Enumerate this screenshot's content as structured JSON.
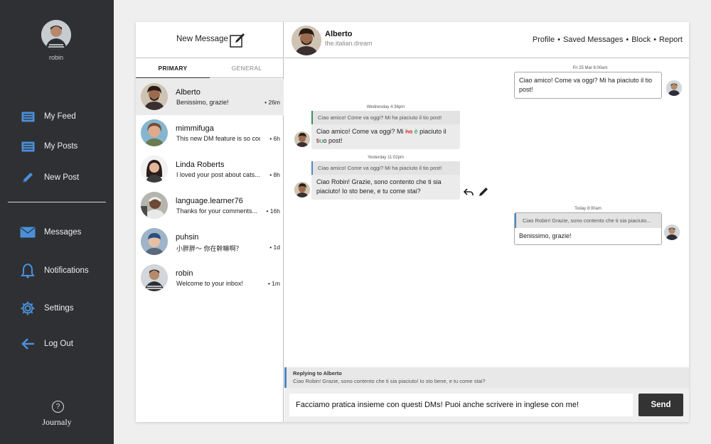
{
  "sidebar": {
    "user_name": "robin",
    "nav": [
      {
        "label": "My Feed",
        "icon": "feed-icon"
      },
      {
        "label": "My Posts",
        "icon": "posts-icon"
      },
      {
        "label": "New Post",
        "icon": "pencil-icon"
      },
      {
        "label": "Messages",
        "icon": "envelope-icon"
      },
      {
        "label": "Notifications",
        "icon": "bell-icon"
      },
      {
        "label": "Settings",
        "icon": "gear-icon"
      },
      {
        "label": "Log Out",
        "icon": "arrow-left-icon"
      }
    ],
    "help": "?",
    "brand": "Journaly",
    "accent": "#4a90d9"
  },
  "inbox": {
    "new_message_label": "New Message",
    "tabs": [
      "PRIMARY",
      "GENERAL"
    ],
    "conversations": [
      {
        "name": "Alberto",
        "preview": "Benissimo, grazie!",
        "time": "• 26m",
        "active": true
      },
      {
        "name": "mimmifuga",
        "preview": "This new DM feature is so cool!",
        "time": "• 6h"
      },
      {
        "name": "Linda Roberts",
        "preview": "I loved your post about cats...",
        "time": "• 8h"
      },
      {
        "name": "language.learner76",
        "preview": "Thanks for your comments...",
        "time": "• 16h"
      },
      {
        "name": "puhsin",
        "preview": "小胖胖～ 你在幹嘛啊？",
        "time": "• 1d"
      },
      {
        "name": "robin",
        "preview": "Welcome to your inbox!",
        "time": "• 1m"
      }
    ]
  },
  "chat": {
    "name": "Alberto",
    "handle": "the.italian.dream",
    "actions": [
      "Profile",
      "Saved Messages",
      "Block",
      "Report"
    ],
    "messages": {
      "m1": {
        "timestamp": "Fri 25 Mar 6:00am",
        "text": "Ciao amico! Come va oggi? Mi ha piaciuto il tio post!"
      },
      "m2": {
        "timestamp": "Wednesday 4:36pm",
        "quote": "Ciao amico! Come va oggi? Mi ha piaciuto il tio post!",
        "text_a": "Ciao amico! Come va oggi? Mi ",
        "strike_1": "ha",
        "insert_1": "è",
        "text_b": " piaciuto il",
        "text_c": "t",
        "strike_2": "i",
        "insert_2": "u",
        "text_d": "o post!"
      },
      "m3": {
        "timestamp": "Yesterday 11:02pm",
        "quote": "Ciao amico! Come va oggi? Mi ha piaciuto il tio post!",
        "text": "Ciao Robin! Grazie, sono contento che ti sia piaciuto! Io sto bene, e tu come stai?"
      },
      "m4": {
        "timestamp": "Today 8:00am",
        "quote": "Ciao Robin! Grazie, sono contento che ti sia piaciuto...",
        "text": "Benissimo, grazie!"
      }
    },
    "reply": {
      "title": "Replying to Alberto",
      "text": "Ciao Robin! Grazie, sono contento che ti sia piaciuto! Io sto bene, e tu come stai?"
    },
    "composer": {
      "value": "Facciamo pratica insieme con questi DMs! Puoi anche scrivere in inglese con me!",
      "send_label": "Send"
    }
  }
}
